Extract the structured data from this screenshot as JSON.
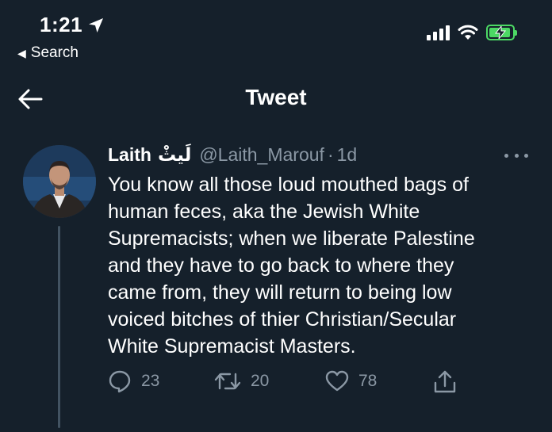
{
  "status_bar": {
    "time": "1:21",
    "back_app": "Search"
  },
  "nav": {
    "title": "Tweet"
  },
  "tweet": {
    "display_name": "Laith",
    "display_name_arabic": "لَيثْ",
    "handle": "@Laith_Marouf",
    "separator": "·",
    "time_ago": "1d",
    "lines": [
      "You know all those loud mouthed bags of",
      "human feces, aka the Jewish White",
      "Supremacists; when we liberate Palestine",
      "and they have to go back to where they",
      "came from, they will return to being low",
      "voiced bitches of thier Christian/Secular",
      "White Supremacist Masters."
    ],
    "actions": {
      "replies": "23",
      "retweets": "20",
      "likes": "78"
    }
  },
  "colors": {
    "background": "#15202b",
    "muted": "#8b98a5",
    "battery": "#4cd964",
    "thread_line": "#425362"
  },
  "icons": [
    "location-arrow-icon",
    "signal-icon",
    "wifi-icon",
    "battery-charging-icon",
    "back-arrow-icon",
    "more-icon",
    "reply-icon",
    "retweet-icon",
    "like-icon",
    "share-icon"
  ]
}
